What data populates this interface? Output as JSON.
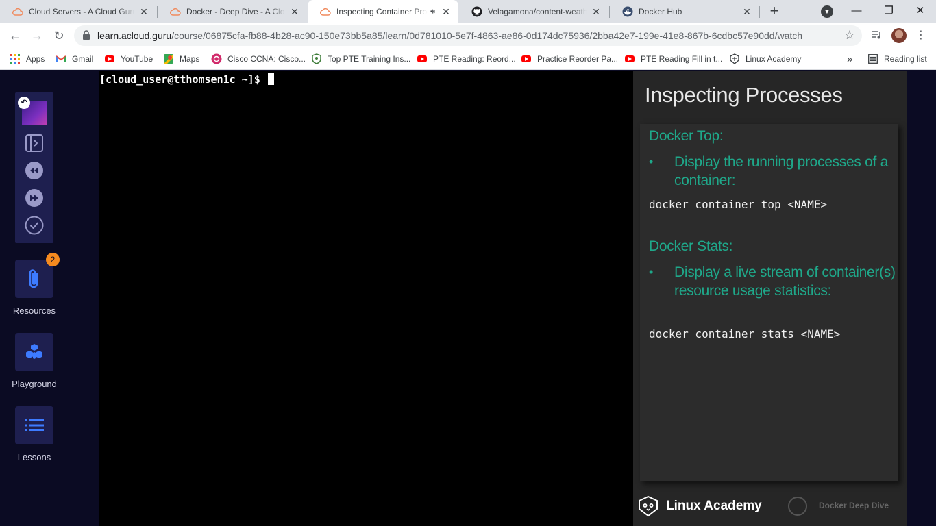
{
  "browser": {
    "tabs": [
      {
        "title": "Cloud Servers - A Cloud Guru",
        "icon": "cloud-icon",
        "active": false
      },
      {
        "title": "Docker - Deep Dive - A Cloud Guru",
        "icon": "cloud-icon",
        "active": false
      },
      {
        "title": "Inspecting Container Processes",
        "icon": "cloud-icon",
        "active": true,
        "audio": true
      },
      {
        "title": "Velagamona/content-weather-app",
        "icon": "github-icon",
        "active": false
      },
      {
        "title": "Docker Hub",
        "icon": "docker-icon",
        "active": false
      }
    ],
    "url": {
      "host": "learn.acloud.guru",
      "path": "/course/06875cfa-fb88-4b28-ac90-150e73bb5a85/learn/0d781010-5e7f-4863-ae86-0d174dc75936/2bba42e7-199e-41e8-867b-6cdbc57e90dd/watch"
    },
    "bookmarks": [
      {
        "label": "Apps",
        "icon": "apps-grid-icon"
      },
      {
        "label": "Gmail",
        "icon": "gmail-icon"
      },
      {
        "label": "YouTube",
        "icon": "youtube-icon"
      },
      {
        "label": "Maps",
        "icon": "maps-icon"
      },
      {
        "label": "Cisco CCNA: Cisco...",
        "icon": "cisco-icon"
      },
      {
        "label": "Top PTE Training Ins...",
        "icon": "pte-shield-icon"
      },
      {
        "label": "PTE Reading: Reord...",
        "icon": "youtube-icon"
      },
      {
        "label": "Practice Reorder Pa...",
        "icon": "youtube-icon"
      },
      {
        "label": "PTE Reading Fill in t...",
        "icon": "youtube-icon"
      },
      {
        "label": "Linux Academy",
        "icon": "linux-academy-icon"
      }
    ],
    "more_bookmarks": "»",
    "reading_list": "Reading list"
  },
  "sidebar": {
    "resources_label": "Resources",
    "resources_badge": "2",
    "playground_label": "Playground",
    "lessons_label": "Lessons"
  },
  "terminal": {
    "prompt": "[cloud_user@tthomsen1c ~]$"
  },
  "slide": {
    "title": "Inspecting Processes",
    "section1_heading": "Docker Top:",
    "section1_bullet": "Display the running processes of a container:",
    "section1_code": "docker container top <NAME>",
    "section2_heading": "Docker Stats:",
    "section2_bullet": "Display a live stream of container(s) resource usage statistics:",
    "section2_code": "docker container stats <NAME>",
    "footer_brand": "Linux Academy",
    "footer_course": "Docker Deep Dive"
  },
  "colors": {
    "accent_green": "#1fa88a",
    "page_bg": "#0b0b23",
    "badge_orange": "#f58a1f",
    "nav_card": "#1e1f4f"
  }
}
